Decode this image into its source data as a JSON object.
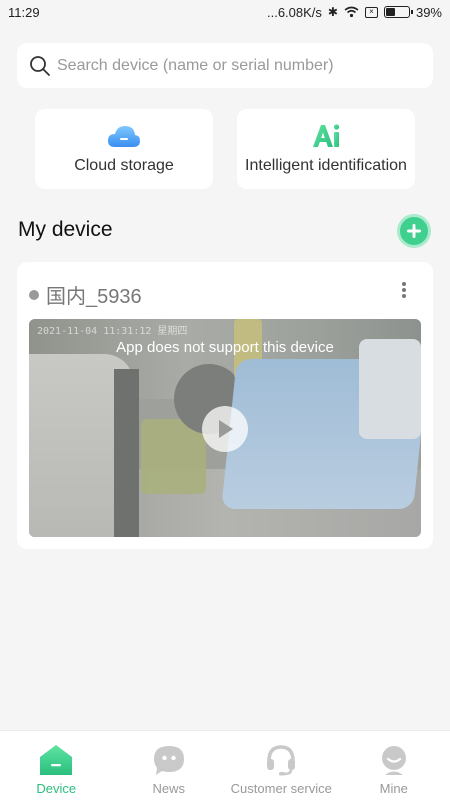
{
  "status_bar": {
    "time": "11:29",
    "network_speed": "...6.08K/s",
    "battery_text": "39%",
    "battery_level": 0.39,
    "icons": [
      "bluetooth-icon",
      "wifi-icon",
      "sim-icon",
      "battery-icon"
    ]
  },
  "search": {
    "placeholder": "Search device (name or serial number)",
    "value": ""
  },
  "features": [
    {
      "label": "Cloud storage",
      "icon": "cloud-storage-icon"
    },
    {
      "label": "Intelligent identification",
      "icon": "ai-icon"
    }
  ],
  "section": {
    "title": "My device"
  },
  "device": {
    "name": "国内_5936",
    "status": "offline",
    "timestamp": "2021-11-04 11:31:12 星期四",
    "message": "App does not support this device"
  },
  "nav": {
    "items": [
      {
        "label": "Device",
        "icon": "device-home-icon",
        "active": true
      },
      {
        "label": "News",
        "icon": "news-chat-icon",
        "active": false
      },
      {
        "label": "Customer service",
        "icon": "headset-icon",
        "active": false
      },
      {
        "label": "Mine",
        "icon": "profile-icon",
        "active": false
      }
    ]
  },
  "colors": {
    "accent": "#3fcf8e",
    "background": "#f5f5f5",
    "card": "#ffffff"
  }
}
